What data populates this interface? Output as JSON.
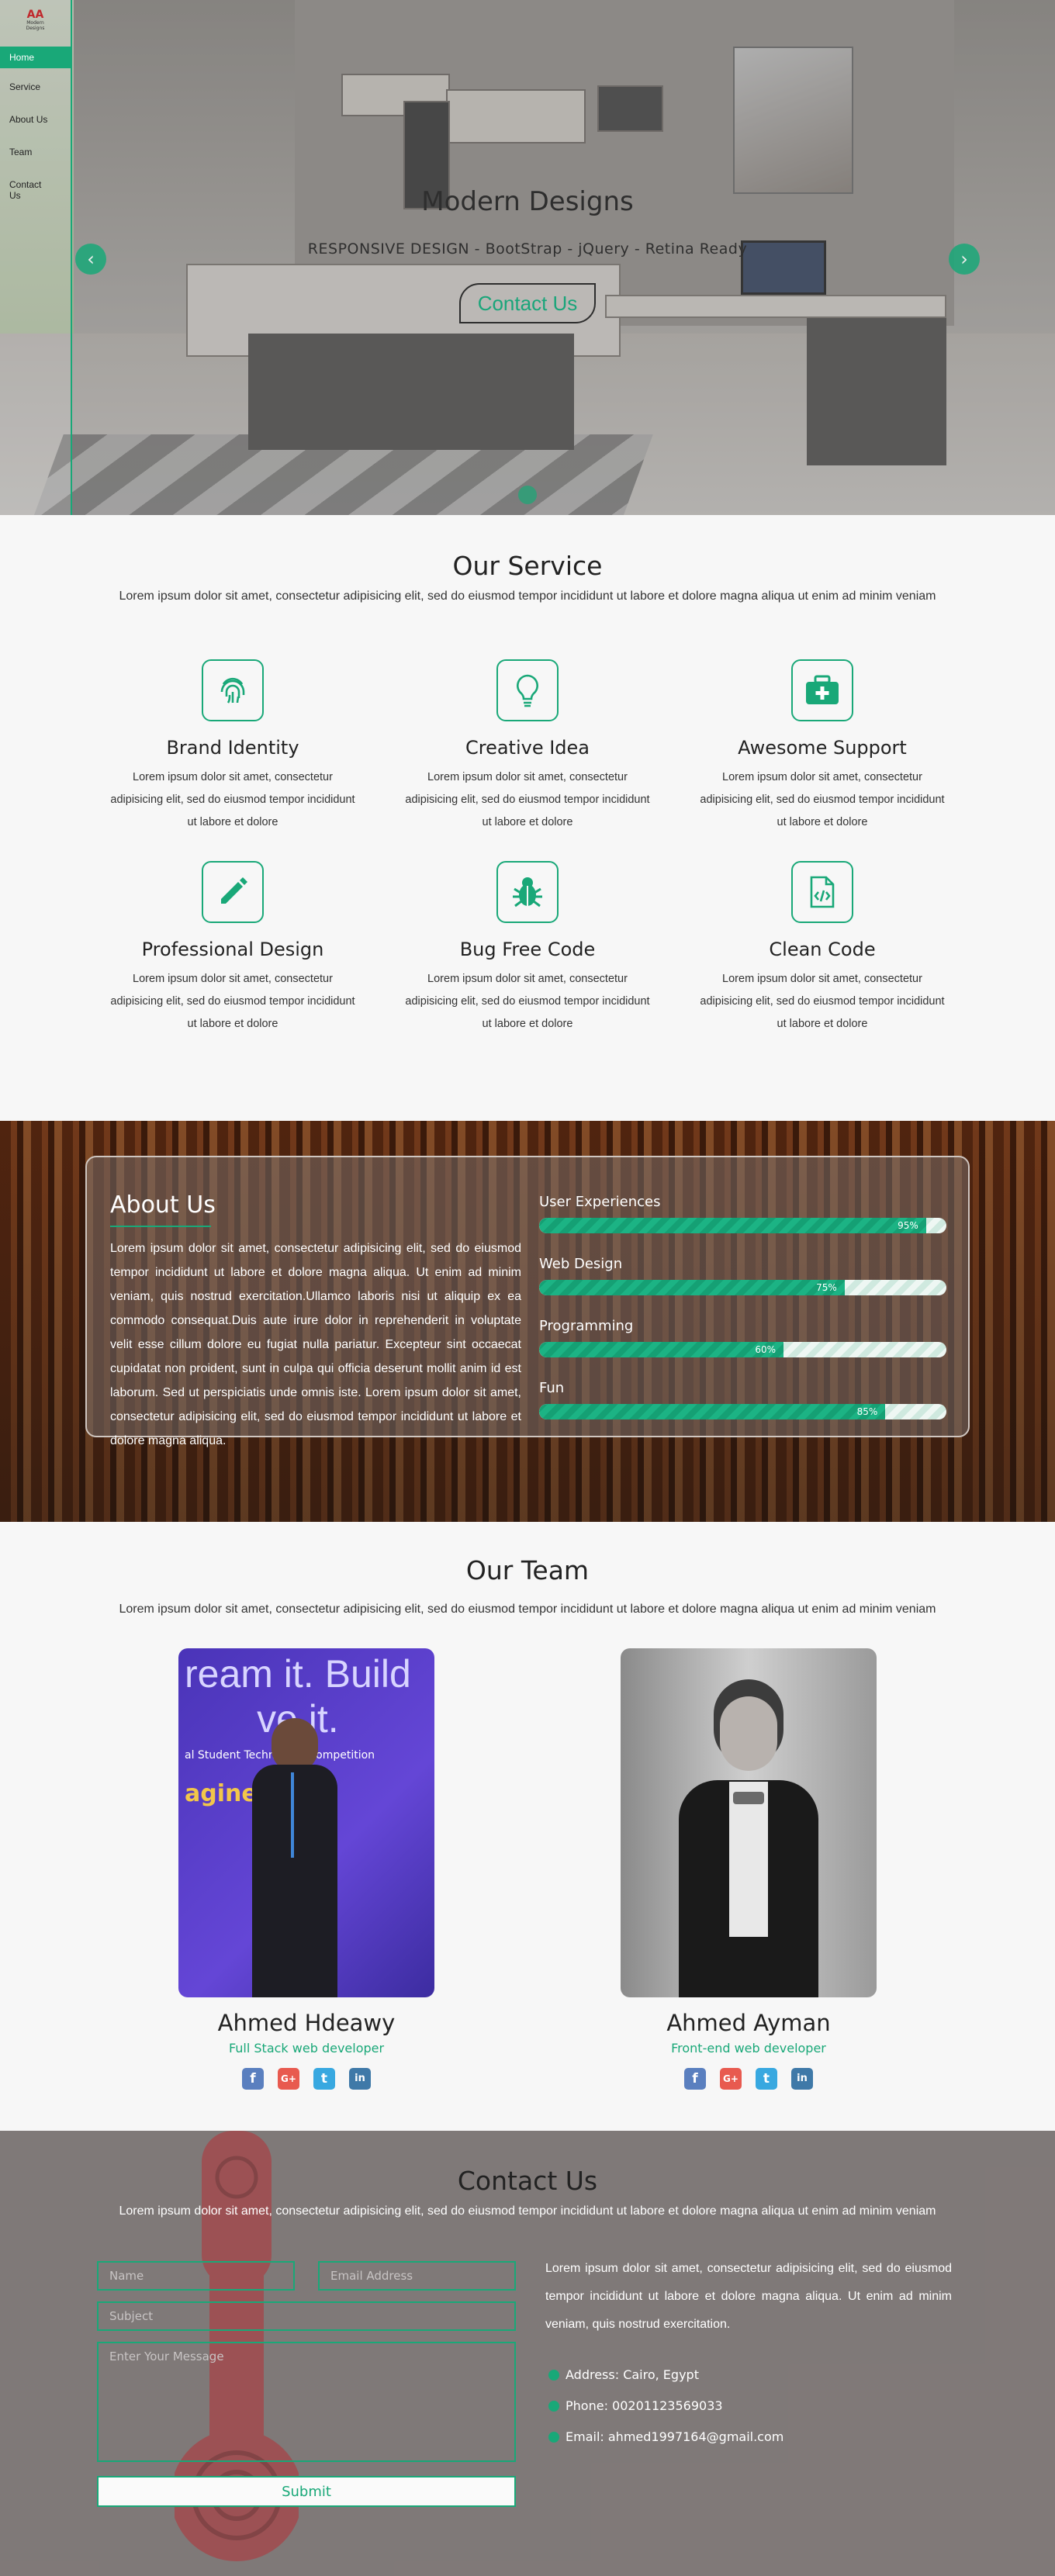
{
  "sidebar": {
    "logo_text": "Modern Designs",
    "items": [
      {
        "label": "Home"
      },
      {
        "label": "Service"
      },
      {
        "label": "About Us"
      },
      {
        "label": "Team"
      },
      {
        "label": "Contact Us"
      }
    ]
  },
  "hero": {
    "title": "Modern Designs",
    "subtitle": "RESPONSIVE DESIGN - BootStrap - jQuery - Retina Ready",
    "button": "Contact Us",
    "prev": "‹",
    "next": "›"
  },
  "services": {
    "title": "Our Service",
    "description": "Lorem ipsum dolor sit amet, consectetur adipisicing elit, sed do eiusmod tempor incididunt ut labore et dolore magna aliqua ut enim ad minim veniam",
    "items": [
      {
        "name": "Brand Identity",
        "icon": "fingerprint-icon",
        "text": "Lorem ipsum dolor sit amet, consectetur adipisicing elit, sed do eiusmod tempor incididunt ut labore et dolore"
      },
      {
        "name": "Creative Idea",
        "icon": "lightbulb-icon",
        "text": "Lorem ipsum dolor sit amet, consectetur adipisicing elit, sed do eiusmod tempor incididunt ut labore et dolore"
      },
      {
        "name": "Awesome Support",
        "icon": "medkit-icon",
        "text": "Lorem ipsum dolor sit amet, consectetur adipisicing elit, sed do eiusmod tempor incididunt ut labore et dolore"
      },
      {
        "name": "Professional Design",
        "icon": "pencil-icon",
        "text": "Lorem ipsum dolor sit amet, consectetur adipisicing elit, sed do eiusmod tempor incididunt ut labore et dolore"
      },
      {
        "name": "Bug Free Code",
        "icon": "bug-icon",
        "text": "Lorem ipsum dolor sit amet, consectetur adipisicing elit, sed do eiusmod tempor incididunt ut labore et dolore"
      },
      {
        "name": "Clean Code",
        "icon": "code-file-icon",
        "text": "Lorem ipsum dolor sit amet, consectetur adipisicing elit, sed do eiusmod tempor incididunt ut labore et dolore"
      }
    ]
  },
  "about": {
    "title": "About Us",
    "text": "Lorem ipsum dolor sit amet, consectetur adipisicing elit, sed do eiusmod tempor incididunt ut labore et dolore magna aliqua. Ut enim ad minim veniam, quis nostrud exercitation.Ullamco laboris nisi ut aliquip ex ea commodo consequat.Duis aute irure dolor in reprehenderit in voluptate velit esse cillum dolore eu fugiat nulla pariatur. Excepteur sint occaecat cupidatat non proident, sunt in culpa qui officia deserunt mollit anim id est laborum. Sed ut perspiciatis unde omnis iste. Lorem ipsum dolor sit amet, consectetur adipisicing elit, sed do eiusmod tempor incididunt ut labore et dolore magna aliqua.",
    "skills": [
      {
        "label": "User Experiences",
        "percent": 95,
        "percent_text": "95%"
      },
      {
        "label": "Web Design",
        "percent": 75,
        "percent_text": "75%"
      },
      {
        "label": "Programming",
        "percent": 60,
        "percent_text": "60%"
      },
      {
        "label": "Fun",
        "percent": 85,
        "percent_text": "85%"
      }
    ]
  },
  "team": {
    "title": "Our Team",
    "description": "Lorem ipsum dolor sit amet, consectetur adipisicing elit, sed do eiusmod tempor incididunt ut labore et dolore magna aliqua ut enim ad minim veniam",
    "members": [
      {
        "name": "Ahmed Hdeawy",
        "role": "Full Stack web developer",
        "photo_text": "ream it. Build\nve it.",
        "photo_text2": "al Student Technology Competition",
        "photo_text3": "aginecup"
      },
      {
        "name": "Ahmed Ayman",
        "role": "Front-end web developer"
      }
    ],
    "social_icons": [
      "facebook-icon",
      "google-plus-icon",
      "twitter-icon",
      "linkedin-icon"
    ],
    "social_glyphs": {
      "facebook": "f",
      "google": "G+",
      "twitter": "t",
      "linkedin": "in"
    },
    "colors": {
      "facebook": "#5a7fbf",
      "google": "#e85a4f",
      "twitter": "#38a8e0",
      "linkedin": "#3f79a8"
    }
  },
  "contact": {
    "title": "Contact Us",
    "description": "Lorem ipsum dolor sit amet, consectetur adipisicing elit, sed do eiusmod tempor incididunt ut labore et dolore magna aliqua ut enim ad minim veniam",
    "form": {
      "name_placeholder": "Name",
      "email_placeholder": "Email Address",
      "subject_placeholder": "Subject",
      "message_placeholder": "Enter Your Message",
      "submit_label": "Submit"
    },
    "text": "Lorem ipsum dolor sit amet, consectetur adipisicing elit, sed do eiusmod tempor incididunt ut labore et dolore magna aliqua. Ut enim ad minim veniam, quis nostrud exercitation.",
    "address": "Address: Cairo, Egypt",
    "phone": "Phone: 00201123569033",
    "email": "Email: ahmed1997164@gmail.com"
  },
  "colors": {
    "accent": "#19a878"
  }
}
